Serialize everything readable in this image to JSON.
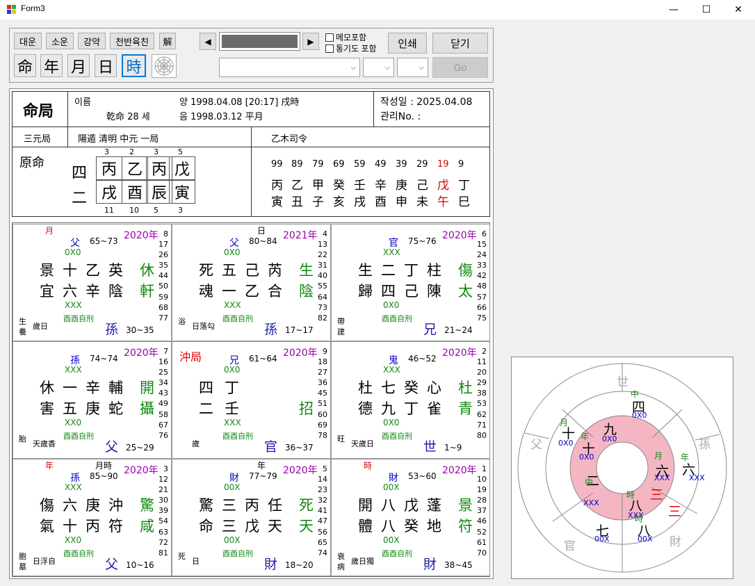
{
  "window": {
    "title": "Form3",
    "min": "—",
    "max": "☐",
    "close": "✕"
  },
  "toolbar": {
    "tabs": [
      "대운",
      "소운",
      "강약",
      "천반육친",
      "解"
    ],
    "pillars": [
      "命",
      "年",
      "月",
      "日",
      "時"
    ],
    "memo": "메모포함",
    "tonggi": "통기도 포함",
    "print": "인쇄",
    "close": "닫기",
    "go": "Go",
    "prev": "◀",
    "next": "▶"
  },
  "header": {
    "title": "命局",
    "name_label": "이름",
    "age": "乾命 28 세",
    "solar": "양 1998.04.08  [20:17]  戌時",
    "lunar": "음 1998.03.12  平月",
    "date": "작성일 : 2025.04.08",
    "manage": "관리No. :",
    "sanwon": "三元局",
    "ju": "陽遁 清明 中元 一局",
    "saryeong": "乙木司令"
  },
  "wonmyeong": {
    "label": "原命",
    "side": [
      "四",
      "二"
    ],
    "top_nums": [
      "3",
      "2",
      "3",
      "5"
    ],
    "stems": [
      "丙",
      "乙",
      "丙",
      "戊"
    ],
    "branches": [
      "戌",
      "酉",
      "辰",
      "寅"
    ],
    "bot_nums": [
      "11",
      "10",
      "5",
      "3"
    ]
  },
  "daeun": {
    "ages": [
      "99",
      "89",
      "79",
      "69",
      "59",
      "49",
      "39",
      "29",
      "19",
      "9"
    ],
    "stems": [
      "丙",
      "乙",
      "甲",
      "癸",
      "壬",
      "辛",
      "庚",
      "己",
      "戊",
      "丁"
    ],
    "branches": [
      "寅",
      "丑",
      "子",
      "亥",
      "戌",
      "酉",
      "申",
      "未",
      "午",
      "巳"
    ],
    "highlight": "19"
  },
  "palaces": [
    {
      "tag": "月",
      "tag2": "",
      "year": "2020年",
      "rel": "父",
      "range": "65~73",
      "mark": "0X0",
      "r1": "景十乙英",
      "g1": "休",
      "r2": "宜六辛陰",
      "g2": "軒",
      "mark2": "XXX",
      "hyeong": "酉酉自刑",
      "bl": "生\n養",
      "bl2": "歲日",
      "god": "孫",
      "age": "30~35",
      "nums": "8\n17\n26\n35\n44\n50\n59\n68\n77"
    },
    {
      "tag": "",
      "tag2": "日",
      "year": "2021年",
      "rel": "父",
      "range": "80~84",
      "mark": "0X0",
      "r1": "死五己芮",
      "g1": "生",
      "r2": "魂一乙合",
      "g2": "陰",
      "mark2": "XXX",
      "hyeong": "酉酉自刑",
      "bl": "浴",
      "bl2": "日落勾",
      "god": "孫",
      "age": "17~17",
      "nums": "4\n13\n22\n31\n40\n55\n64\n73\n82"
    },
    {
      "tag": "",
      "tag2": "",
      "year": "2020年",
      "rel": "官",
      "range": "75~76",
      "mark": "XXX",
      "r1": "生二丁柱",
      "g1": "傷",
      "r2": "歸四己陳",
      "g2": "太",
      "mark2": "0X0",
      "hyeong": "酉酉自刑",
      "bl": "帶\n建",
      "bl2": "",
      "god": "兄",
      "age": "21~24",
      "nums": "6\n15\n24\n33\n42\n48\n57\n66\n75"
    },
    {
      "tag": "",
      "tag2": "",
      "year": "2020年",
      "rel": "孫",
      "range": "74~74",
      "mark": "XXX",
      "r1": "休一辛輔",
      "g1": "開",
      "r2": "害五庚蛇",
      "g2": "攝",
      "mark2": "XX0",
      "hyeong": "酉酉自刑",
      "bl": "胎",
      "bl2": "天歲香",
      "god": "父",
      "age": "25~29",
      "nums": "7\n16\n25\n34\n43\n49\n58\n67\n76"
    },
    {
      "tag": "沖局",
      "tag2": "",
      "year": "2020年",
      "rel": "兄",
      "range": "61~64",
      "mark": "0X0",
      "r1": "四丁",
      "g1": "",
      "r2": "二壬",
      "g2": "招",
      "mark2": "XXX",
      "hyeong": "酉酉自刑",
      "bl": "",
      "bl2": "歲",
      "god": "官",
      "age": "36~37",
      "nums": "9\n18\n27\n36\n45\n51\n60\n69\n78"
    },
    {
      "tag": "",
      "tag2": "",
      "year": "2020年",
      "rel": "鬼",
      "range": "46~52",
      "mark": "XXX",
      "r1": "杜七癸心",
      "g1": "杜",
      "r2": "德九丁雀",
      "g2": "青",
      "mark2": "0X0",
      "hyeong": "酉酉自刑",
      "bl": "旺",
      "bl2": "天歲日",
      "god": "世",
      "age": "1~9",
      "nums": "2\n11\n20\n29\n38\n53\n62\n71\n80"
    },
    {
      "tag": "年",
      "tag2": "月時",
      "year": "2020年",
      "rel": "孫",
      "range": "85~90",
      "mark": "XXX",
      "r1": "傷六庚沖",
      "g1": "驚",
      "r2": "氣十丙符",
      "g2": "咸",
      "mark2": "XX0",
      "hyeong": "酉酉自刑",
      "bl": "胞\n墓",
      "bl2": "日浮自",
      "god": "父",
      "age": "10~16",
      "nums": "3\n12\n21\n30\n39\n54\n63\n72\n81"
    },
    {
      "tag": "",
      "tag2": "年",
      "year": "2020年",
      "rel": "財",
      "range": "77~79",
      "mark": "00X",
      "r1": "驚三丙任",
      "g1": "死",
      "r2": "命三戊天",
      "g2": "天",
      "mark2": "00X",
      "hyeong": "酉酉自刑",
      "bl": "死",
      "bl2": "日",
      "god": "財",
      "age": "18~20",
      "nums": "5\n14\n23\n32\n41\n47\n56\n65\n74"
    },
    {
      "tag": "時",
      "tag2": "",
      "year": "2020年",
      "rel": "財",
      "range": "53~60",
      "mark": "00X",
      "r1": "開八戊蓬",
      "g1": "景",
      "r2": "體八癸地",
      "g2": "符",
      "mark2": "00X",
      "hyeong": "酉酉自刑",
      "bl": "衰\n病",
      "bl2": "歲日獨",
      "god": "財",
      "age": "38~45",
      "nums": "1\n10\n19\n28\n37\n46\n52\n61\n70"
    }
  ],
  "wheel": {
    "outer": [
      "世",
      "孫",
      "財",
      "官",
      "父"
    ],
    "inner_labels": [
      "四",
      "九",
      "十",
      "六",
      "二",
      "八",
      "七",
      "三",
      "六",
      "三",
      "八",
      "十"
    ],
    "marks": [
      "0X0",
      "0X0",
      "0X0",
      "XXX",
      "XXX",
      "XXX",
      "00X",
      "00X",
      "XXX",
      "0X0"
    ],
    "tags": [
      "中",
      "月",
      "年",
      "月",
      "年",
      "中",
      "時",
      "時"
    ]
  },
  "colors": {
    "pink": "#f4b6c2",
    "blue": "#0000cc",
    "green": "#118811",
    "purple": "#9900aa",
    "red": "#dd0000"
  }
}
